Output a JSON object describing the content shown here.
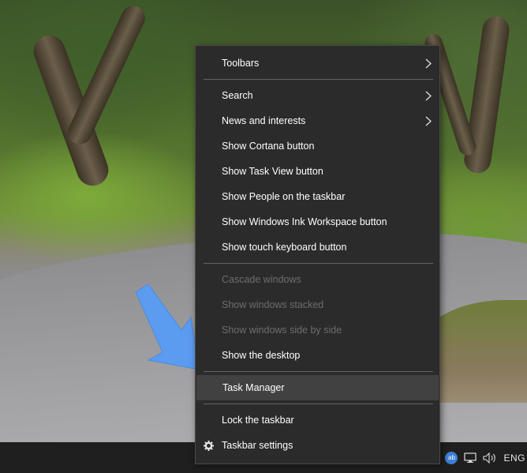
{
  "menu": {
    "toolbars": "Toolbars",
    "search": "Search",
    "news": "News and interests",
    "cortana": "Show Cortana button",
    "taskview": "Show Task View button",
    "people": "Show People on the taskbar",
    "ink": "Show Windows Ink Workspace button",
    "touch": "Show touch keyboard button",
    "cascade": "Cascade windows",
    "stacked": "Show windows stacked",
    "sidebyside": "Show windows side by side",
    "desktop": "Show the desktop",
    "taskmgr": "Task Manager",
    "lock": "Lock the taskbar",
    "settings": "Taskbar settings"
  },
  "tray": {
    "badge": "ab",
    "language": "ENG"
  },
  "colors": {
    "menu_bg": "#2b2b2b",
    "highlight": "#414141",
    "disabled_text": "#6d6d6d",
    "arrow": "#5b9cf0"
  }
}
